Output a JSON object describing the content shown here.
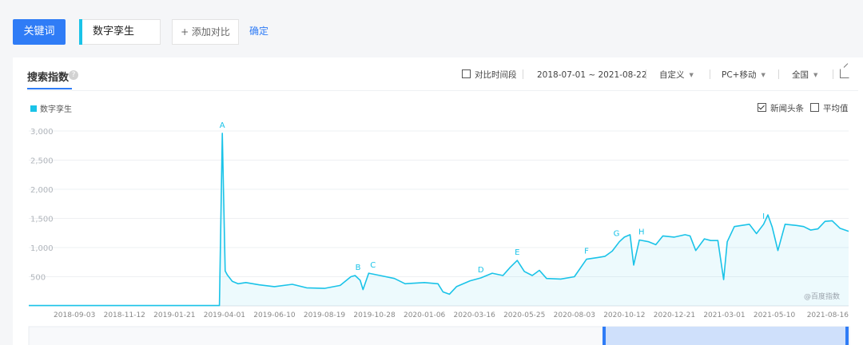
{
  "topbar": {
    "keyword_button": "关键词",
    "keyword_value": "数字孪生",
    "add_compare": "+ 添加对比",
    "confirm": "确定"
  },
  "panel": {
    "tab_title": "搜索指数",
    "help_icon": "?",
    "compare_period": "对比时间段",
    "date_range": "2018-07-01 ~ 2021-08-22",
    "custom": "自定义",
    "platform": "PC+移动",
    "region": "全国",
    "export_icon": "export-icon",
    "legend": "数字孪生",
    "news_headlines": "新闻头条",
    "average": "平均值",
    "watermark": "@百度指数",
    "accent_color": "#1ac3e8",
    "brand_color": "#2f7cf6"
  },
  "chart_data": {
    "type": "area",
    "title": "",
    "xlabel": "",
    "ylabel": "",
    "ylim": [
      0,
      3000
    ],
    "yticks": [
      500,
      1000,
      1500,
      2000,
      2500,
      3000
    ],
    "ytick_labels": [
      "500",
      "1,000",
      "1,500",
      "2,000",
      "2,500",
      "3,000"
    ],
    "xtick_labels": [
      "2018-09-03",
      "2018-11-12",
      "2019-01-21",
      "2019-04-01",
      "2019-06-10",
      "2019-08-19",
      "2019-10-28",
      "2020-01-06",
      "2020-03-16",
      "2020-05-25",
      "2020-08-03",
      "2020-10-12",
      "2020-12-21",
      "2021-03-01",
      "2021-05-10",
      "2021-08-16"
    ],
    "series": [
      {
        "name": "数字孪生",
        "x": [
          "2018-07-01",
          "2019-03-25",
          "2019-03-29",
          "2019-04-02",
          "2019-04-05",
          "2019-04-12",
          "2019-04-20",
          "2019-05-01",
          "2019-05-20",
          "2019-06-10",
          "2019-07-05",
          "2019-07-25",
          "2019-08-19",
          "2019-09-10",
          "2019-09-25",
          "2019-10-01",
          "2019-10-08",
          "2019-10-12",
          "2019-10-20",
          "2019-11-05",
          "2019-11-25",
          "2019-12-10",
          "2020-01-06",
          "2020-01-25",
          "2020-02-01",
          "2020-02-10",
          "2020-02-20",
          "2020-03-10",
          "2020-03-25",
          "2020-04-10",
          "2020-04-25",
          "2020-05-05",
          "2020-05-15",
          "2020-05-25",
          "2020-06-05",
          "2020-06-15",
          "2020-06-25",
          "2020-07-15",
          "2020-08-03",
          "2020-08-20",
          "2020-09-05",
          "2020-09-15",
          "2020-09-25",
          "2020-10-05",
          "2020-10-12",
          "2020-10-20",
          "2020-10-25",
          "2020-11-02",
          "2020-11-15",
          "2020-11-25",
          "2020-12-05",
          "2020-12-21",
          "2021-01-05",
          "2021-01-12",
          "2021-01-20",
          "2021-02-01",
          "2021-02-10",
          "2021-02-20",
          "2021-02-28",
          "2021-03-05",
          "2021-03-15",
          "2021-03-25",
          "2021-04-05",
          "2021-04-15",
          "2021-04-25",
          "2021-05-01",
          "2021-05-07",
          "2021-05-15",
          "2021-05-25",
          "2021-06-10",
          "2021-06-20",
          "2021-06-30",
          "2021-07-10",
          "2021-07-20",
          "2021-07-30",
          "2021-08-10",
          "2021-08-22"
        ],
        "values": [
          5,
          5,
          2960,
          600,
          530,
          420,
          380,
          400,
          360,
          330,
          370,
          310,
          300,
          350,
          500,
          520,
          440,
          280,
          560,
          520,
          470,
          380,
          400,
          380,
          240,
          200,
          330,
          430,
          480,
          560,
          520,
          660,
          780,
          590,
          520,
          610,
          470,
          460,
          500,
          800,
          830,
          850,
          940,
          1100,
          1180,
          1220,
          700,
          1130,
          1100,
          1050,
          1200,
          1180,
          1220,
          1200,
          950,
          1150,
          1120,
          1120,
          450,
          1100,
          1360,
          1380,
          1400,
          1240,
          1400,
          1560,
          1350,
          950,
          1400,
          1380,
          1360,
          1300,
          1320,
          1450,
          1460,
          1330,
          1280
        ]
      }
    ],
    "annotations": [
      {
        "label": "A",
        "x": "2019-03-29",
        "y": 2960
      },
      {
        "label": "B",
        "x": "2019-10-05",
        "y": 520
      },
      {
        "label": "C",
        "x": "2019-10-26",
        "y": 560
      },
      {
        "label": "D",
        "x": "2020-03-25",
        "y": 480
      },
      {
        "label": "E",
        "x": "2020-05-15",
        "y": 780
      },
      {
        "label": "F",
        "x": "2020-08-20",
        "y": 800
      },
      {
        "label": "G",
        "x": "2020-10-01",
        "y": 1100
      },
      {
        "label": "H",
        "x": "2020-11-05",
        "y": 1130
      },
      {
        "label": "I",
        "x": "2021-04-25",
        "y": 1400
      }
    ],
    "grid": true,
    "legend_position": "top-left"
  }
}
